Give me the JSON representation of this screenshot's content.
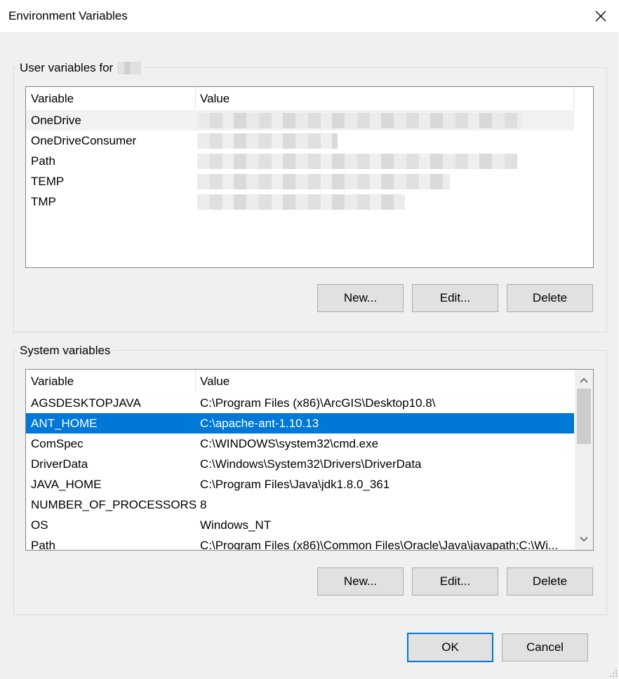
{
  "window": {
    "title": "Environment Variables"
  },
  "user_group": {
    "legend": "User variables for",
    "columns": [
      "Variable",
      "Value"
    ],
    "rows": [
      {
        "variable": "OneDrive",
        "value": ""
      },
      {
        "variable": "OneDriveConsumer",
        "value": ""
      },
      {
        "variable": "Path",
        "value": ""
      },
      {
        "variable": "TEMP",
        "value": ""
      },
      {
        "variable": "TMP",
        "value": ""
      }
    ],
    "buttons": {
      "new": "New...",
      "edit": "Edit...",
      "delete": "Delete"
    }
  },
  "system_group": {
    "legend": "System variables",
    "columns": [
      "Variable",
      "Value"
    ],
    "selected_variable": "ANT_HOME",
    "rows": [
      {
        "variable": "AGSDESKTOPJAVA",
        "value": "C:\\Program Files (x86)\\ArcGIS\\Desktop10.8\\"
      },
      {
        "variable": "ANT_HOME",
        "value": "C:\\apache-ant-1.10.13"
      },
      {
        "variable": "ComSpec",
        "value": "C:\\WINDOWS\\system32\\cmd.exe"
      },
      {
        "variable": "DriverData",
        "value": "C:\\Windows\\System32\\Drivers\\DriverData"
      },
      {
        "variable": "JAVA_HOME",
        "value": "C:\\Program Files\\Java\\jdk1.8.0_361"
      },
      {
        "variable": "NUMBER_OF_PROCESSORS",
        "value": "8"
      },
      {
        "variable": "OS",
        "value": "Windows_NT"
      },
      {
        "variable": "Path",
        "value": "C:\\Program Files (x86)\\Common Files\\Oracle\\Java\\javapath;C:\\Wi..."
      }
    ],
    "buttons": {
      "new": "New...",
      "edit": "Edit...",
      "delete": "Delete"
    }
  },
  "dialog_buttons": {
    "ok": "OK",
    "cancel": "Cancel"
  },
  "icons": {
    "close": "close-icon",
    "scroll_up": "chevron-up-icon",
    "scroll_down": "chevron-down-icon",
    "resize": "resize-grip-icon"
  },
  "colors": {
    "selection": "#0078d7",
    "dialog_background": "#f0f0f0",
    "button_face": "#e1e1e1",
    "default_button_border": "#0078d7"
  }
}
